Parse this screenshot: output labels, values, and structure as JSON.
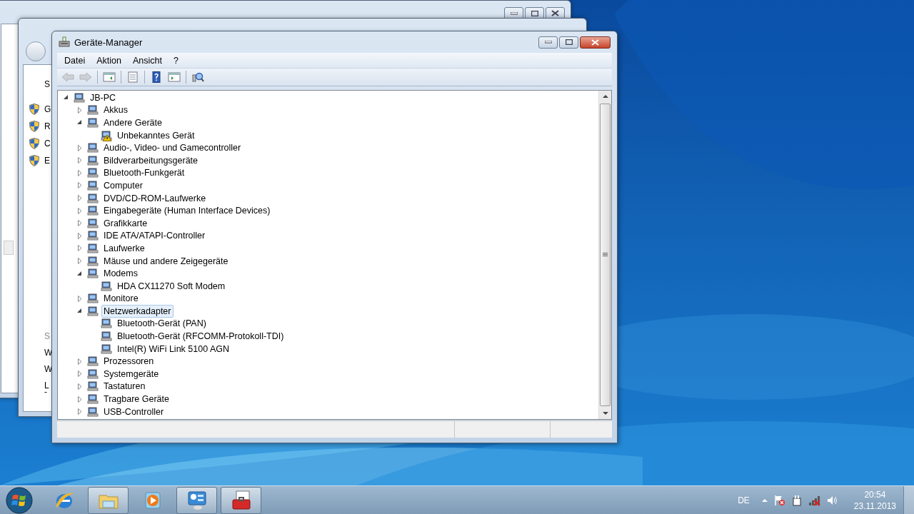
{
  "back_window": {
    "top_links": [
      {
        "label": "S",
        "kind": "heading"
      },
      {
        "label": "G",
        "kind": "shield"
      },
      {
        "label": "R",
        "kind": "shield"
      },
      {
        "label": "C",
        "kind": "shield"
      },
      {
        "label": "E",
        "kind": "shield"
      }
    ],
    "bottom_links": [
      {
        "label": "S",
        "kind": "heading"
      },
      {
        "label": "W",
        "kind": "link"
      },
      {
        "label": "W",
        "kind": "link"
      },
      {
        "label": "L",
        "kind": "link"
      },
      {
        "label": "-",
        "kind": "link"
      }
    ]
  },
  "window": {
    "title": "Geräte-Manager",
    "menu": [
      "Datei",
      "Aktion",
      "Ansicht",
      "?"
    ],
    "toolbar": [
      {
        "kind": "back",
        "disabled": true
      },
      {
        "kind": "forward",
        "disabled": true
      },
      {
        "kind": "separator"
      },
      {
        "kind": "tree",
        "disabled": false
      },
      {
        "kind": "separator"
      },
      {
        "kind": "properties",
        "disabled": false
      },
      {
        "kind": "separator"
      },
      {
        "kind": "help",
        "disabled": false
      },
      {
        "kind": "pane",
        "disabled": false
      },
      {
        "kind": "separator"
      },
      {
        "kind": "scan",
        "disabled": false
      }
    ],
    "tree": {
      "label": "JB-PC",
      "expanded": true,
      "selected": false,
      "warning": false,
      "children": [
        {
          "label": "Akkus",
          "expanded": false,
          "selected": false,
          "warning": false
        },
        {
          "label": "Andere Geräte",
          "expanded": true,
          "selected": false,
          "warning": false,
          "children": [
            {
              "label": "Unbekanntes Gerät",
              "selected": false,
              "warning": true
            }
          ]
        },
        {
          "label": "Audio-, Video- und Gamecontroller",
          "expanded": false,
          "selected": false,
          "warning": false
        },
        {
          "label": "Bildverarbeitungsgeräte",
          "expanded": false,
          "selected": false,
          "warning": false
        },
        {
          "label": "Bluetooth-Funkgerät",
          "expanded": false,
          "selected": false,
          "warning": false
        },
        {
          "label": "Computer",
          "expanded": false,
          "selected": false,
          "warning": false
        },
        {
          "label": "DVD/CD-ROM-Laufwerke",
          "expanded": false,
          "selected": false,
          "warning": false
        },
        {
          "label": "Eingabegeräte (Human Interface Devices)",
          "expanded": false,
          "selected": false,
          "warning": false
        },
        {
          "label": "Grafikkarte",
          "expanded": false,
          "selected": false,
          "warning": false
        },
        {
          "label": "IDE ATA/ATAPI-Controller",
          "expanded": false,
          "selected": false,
          "warning": false
        },
        {
          "label": "Laufwerke",
          "expanded": false,
          "selected": false,
          "warning": false
        },
        {
          "label": "Mäuse und andere Zeigegeräte",
          "expanded": false,
          "selected": false,
          "warning": false
        },
        {
          "label": "Modems",
          "expanded": true,
          "selected": false,
          "warning": false,
          "children": [
            {
              "label": "HDA CX11270 Soft Modem",
              "selected": false,
              "warning": false
            }
          ]
        },
        {
          "label": "Monitore",
          "expanded": false,
          "selected": false,
          "warning": false
        },
        {
          "label": "Netzwerkadapter",
          "expanded": true,
          "selected": true,
          "warning": false,
          "children": [
            {
              "label": "Bluetooth-Gerät (PAN)",
              "selected": false,
              "warning": false
            },
            {
              "label": "Bluetooth-Gerät (RFCOMM-Protokoll-TDI)",
              "selected": false,
              "warning": false
            },
            {
              "label": "Intel(R) WiFi Link 5100 AGN",
              "selected": false,
              "warning": false
            }
          ]
        },
        {
          "label": "Prozessoren",
          "expanded": false,
          "selected": false,
          "warning": false
        },
        {
          "label": "Systemgeräte",
          "expanded": false,
          "selected": false,
          "warning": false
        },
        {
          "label": "Tastaturen",
          "expanded": false,
          "selected": false,
          "warning": false
        },
        {
          "label": "Tragbare Geräte",
          "expanded": false,
          "selected": false,
          "warning": false
        },
        {
          "label": "USB-Controller",
          "expanded": false,
          "selected": false,
          "warning": false
        }
      ]
    }
  },
  "taskbar": {
    "apps": [
      {
        "kind": "browser",
        "running": false
      },
      {
        "kind": "explorer",
        "running": true
      },
      {
        "kind": "media",
        "running": false
      },
      {
        "kind": "control",
        "running": true
      },
      {
        "kind": "toolbox",
        "running": true
      }
    ],
    "language": "DE",
    "time": "20:54",
    "date": "23.11.2013"
  }
}
